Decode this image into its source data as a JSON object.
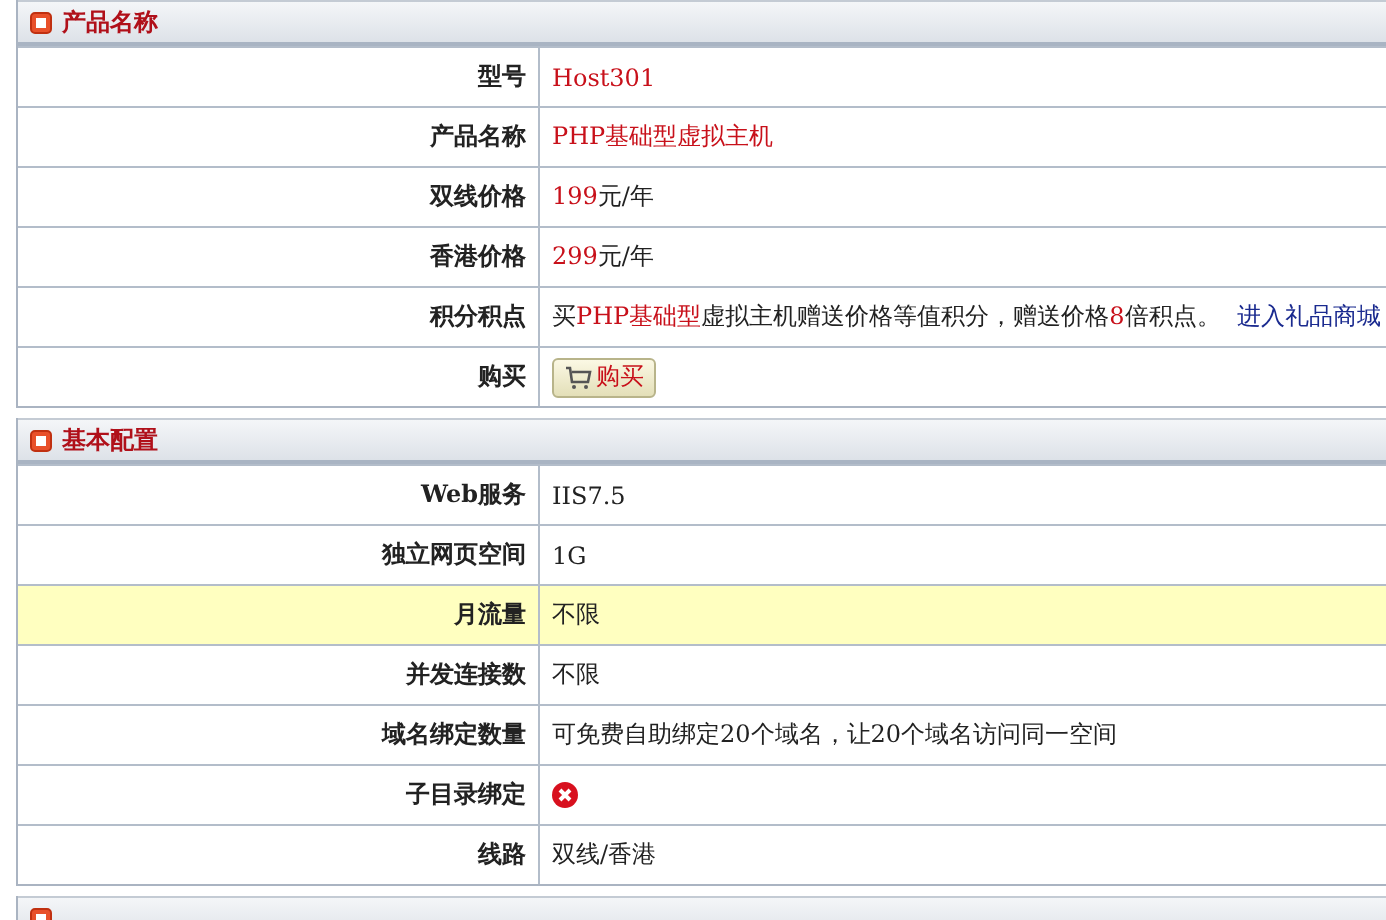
{
  "sections": [
    {
      "title": "产品名称",
      "rows": [
        {
          "label": "型号",
          "kind": "text",
          "highlighted": false,
          "value": [
            {
              "text": "Host301",
              "accent": true
            }
          ]
        },
        {
          "label": "产品名称",
          "kind": "text",
          "highlighted": false,
          "value": [
            {
              "text": "PHP基础型虚拟主机",
              "accent": true
            }
          ]
        },
        {
          "label": "双线价格",
          "kind": "text",
          "highlighted": false,
          "value": [
            {
              "text": "199",
              "accent": true
            },
            {
              "text": "元/年",
              "accent": false
            }
          ]
        },
        {
          "label": "香港价格",
          "kind": "text",
          "highlighted": false,
          "value": [
            {
              "text": "299",
              "accent": true
            },
            {
              "text": "元/年",
              "accent": false
            }
          ]
        },
        {
          "label": "积分积点",
          "kind": "text",
          "highlighted": false,
          "value": [
            {
              "text": "买",
              "accent": false
            },
            {
              "text": "PHP基础型",
              "accent": true
            },
            {
              "text": "虚拟主机赠送价格等值积分，赠送价格",
              "accent": false
            },
            {
              "text": "8",
              "accent": true
            },
            {
              "text": "倍积点。",
              "accent": false
            }
          ],
          "link": "进入礼品商城"
        },
        {
          "label": "购买",
          "kind": "button",
          "highlighted": false,
          "button": "购买"
        }
      ]
    },
    {
      "title": "基本配置",
      "rows": [
        {
          "label": "Web服务",
          "kind": "text",
          "highlighted": false,
          "value": [
            {
              "text": "IIS7.5",
              "accent": false
            }
          ]
        },
        {
          "label": "独立网页空间",
          "kind": "text",
          "highlighted": false,
          "value": [
            {
              "text": "1G",
              "accent": false
            }
          ]
        },
        {
          "label": "月流量",
          "kind": "text",
          "highlighted": true,
          "value": [
            {
              "text": "不限",
              "accent": false
            }
          ]
        },
        {
          "label": "并发连接数",
          "kind": "text",
          "highlighted": false,
          "value": [
            {
              "text": "不限",
              "accent": false
            }
          ]
        },
        {
          "label": "域名绑定数量",
          "kind": "text",
          "highlighted": false,
          "value": [
            {
              "text": "可免费自助绑定20个域名，让20个域名访问同一空间",
              "accent": false
            }
          ]
        },
        {
          "label": "子目录绑定",
          "kind": "unsupported",
          "highlighted": false
        },
        {
          "label": "线路",
          "kind": "text",
          "highlighted": false,
          "value": [
            {
              "text": "双线/香港",
              "accent": false
            }
          ]
        }
      ]
    },
    {
      "cut": true
    }
  ]
}
